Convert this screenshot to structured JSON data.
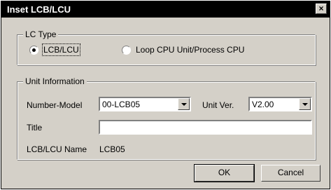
{
  "window": {
    "title": "Inset LCB/LCU",
    "close_glyph": "×"
  },
  "lc_type": {
    "legend": "LC Type",
    "options": [
      {
        "label": "LCB/LCU",
        "selected": true
      },
      {
        "label": "Loop CPU Unit/Process CPU",
        "selected": false
      }
    ]
  },
  "unit_info": {
    "legend": "Unit Information",
    "number_model_label": "Number-Model",
    "number_model_value": "00-LCB05",
    "unit_ver_label": "Unit Ver.",
    "unit_ver_value": "V2.00",
    "title_label": "Title",
    "title_value": "",
    "name_label": "LCB/LCU Name",
    "name_value": "LCB05"
  },
  "buttons": {
    "ok": "OK",
    "cancel": "Cancel"
  }
}
